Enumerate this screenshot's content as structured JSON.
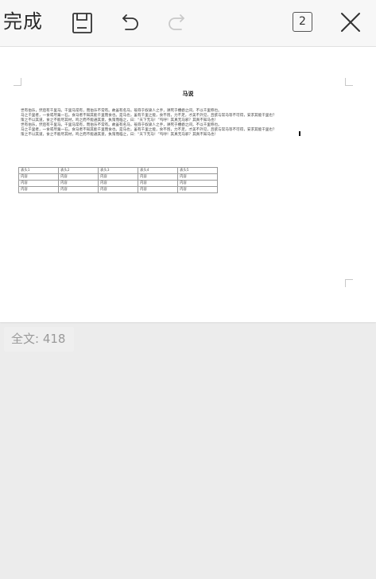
{
  "toolbar": {
    "done_label": "完成",
    "page_count": "2",
    "icons": {
      "save": "save-icon",
      "undo": "undo-icon",
      "redo": "redo-icon",
      "close": "close-icon"
    }
  },
  "document": {
    "title": "马说",
    "paragraphs": [
      "世有伯乐，然后有千里马。千里马常有，而伯乐不常有。故虽有名马，祗辱于奴隶人之手，骈死于槽枥之间，不以千里称也。",
      "马之千里者，一食或尽粟一石。食马者不知其能千里而食也。是马也，虽有千里之能，食不饱，力不足，才美不外见，且欲与常马等不可得，安求其能千里也？",
      "策之不以其道，食之不能尽其材，鸣之而不能通其意，执策而临之，曰：“天下无马！”呜呼！其真无马邪？其真不知马也！",
      "世有伯乐，然后有千里马。千里马常有，而伯乐不常有。故虽有名马，祗辱于奴隶人之手，骈死于槽枥之间，不以千里称也。",
      "马之千里者，一食或尽粟一石。食马者不知其能千里而食也。是马也，虽有千里之能，食不饱，力不足，才美不外见，且欲与常马等不可得，安求其能千里也？",
      "策之不以其道，食之不能尽其材，鸣之而不能通其意，执策而临之，曰：“天下无马！”呜呼！其真无马邪？其真不知马也！"
    ],
    "table": {
      "headers": [
        "表头1",
        "表头2",
        "表头3",
        "表头4",
        "表头5"
      ],
      "rows": [
        [
          "内容",
          "内容",
          "内容",
          "内容",
          "内容"
        ],
        [
          "内容",
          "内容",
          "内容",
          "内容",
          "内容"
        ],
        [
          "内容",
          "内容",
          "内容",
          "内容",
          "内容"
        ]
      ]
    }
  },
  "status": {
    "word_count": "全文: 418"
  }
}
